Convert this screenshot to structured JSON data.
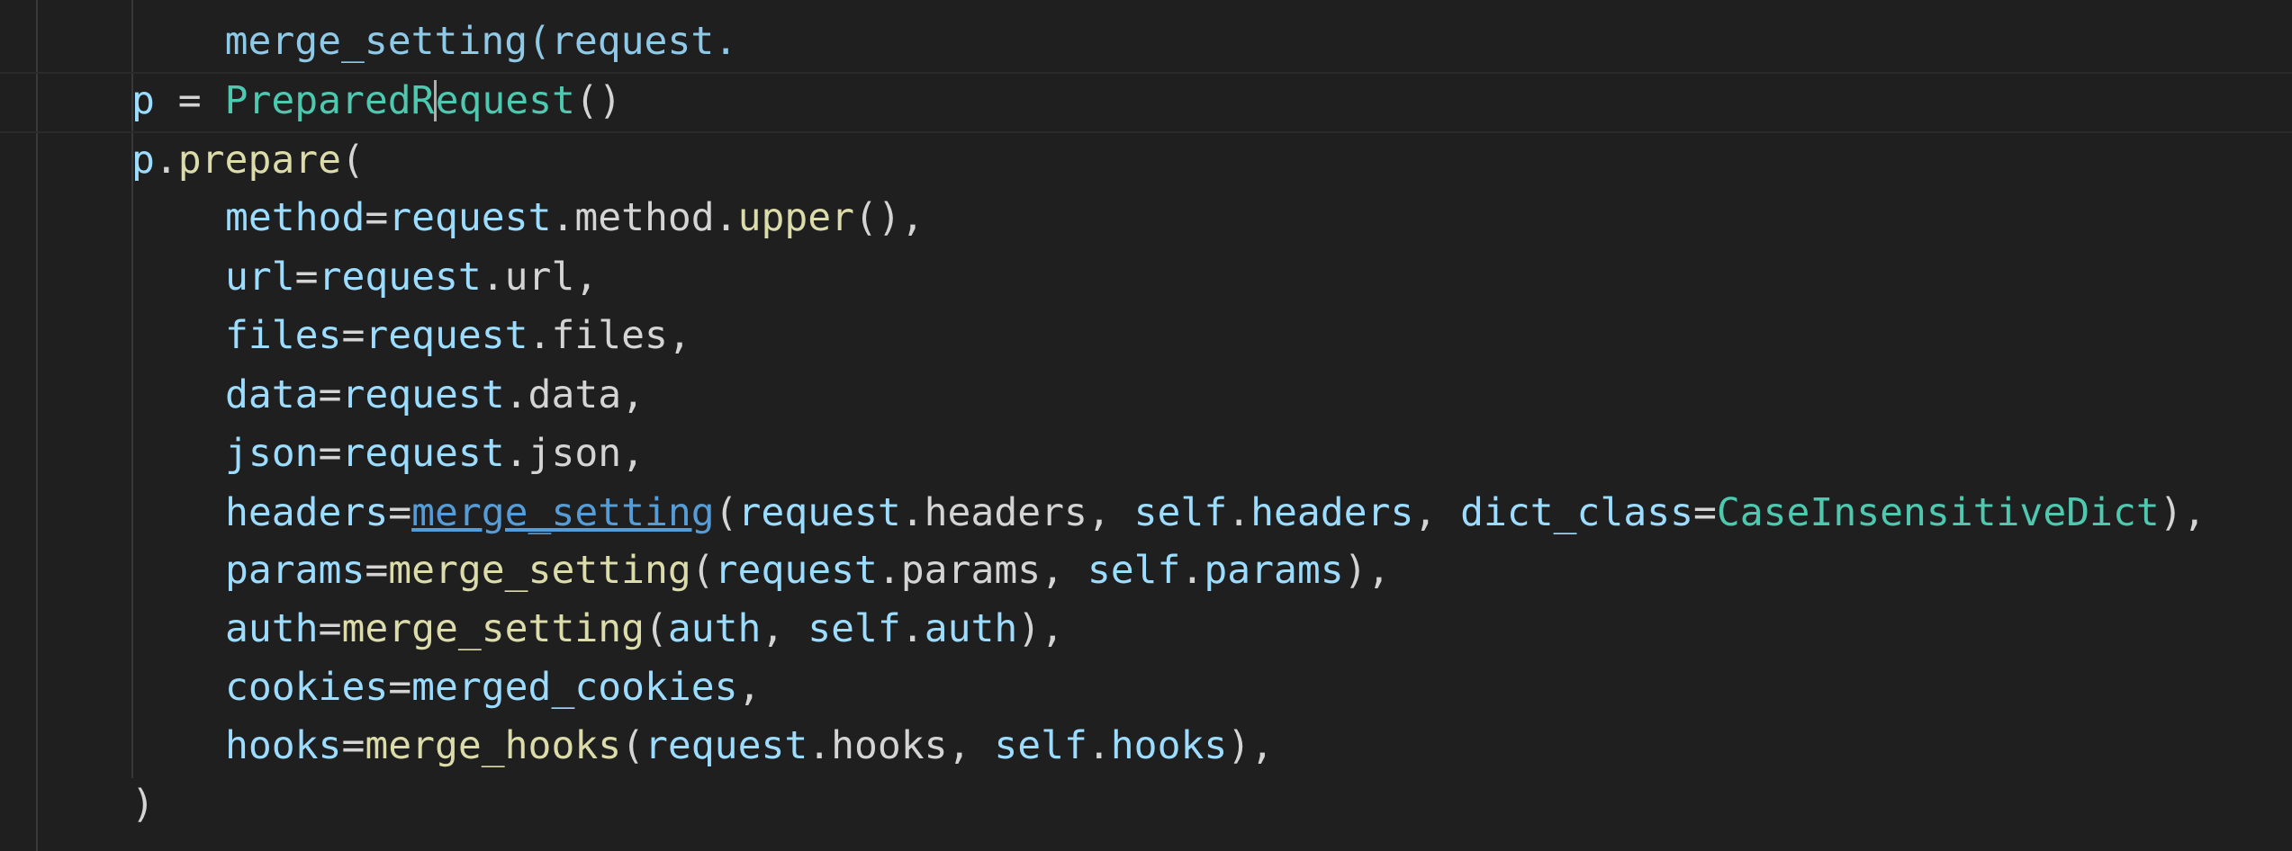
{
  "editor": {
    "colors": {
      "background": "#1f1f1f",
      "variable": "#9cdcfe",
      "class": "#4ec9b0",
      "function": "#dcdcaa",
      "plain": "#d4d4d4",
      "link": "#569cd6"
    },
    "partial_line": "merge_setting(request.",
    "lines": [
      {
        "id": "l1",
        "tokens": [
          {
            "t": "p",
            "c": "var"
          },
          {
            "t": " = ",
            "c": "plain"
          },
          {
            "t": "PreparedR",
            "c": "cls"
          },
          {
            "t": "|cursor|",
            "c": "cursor"
          },
          {
            "t": "equest",
            "c": "cls"
          },
          {
            "t": "()",
            "c": "plain"
          }
        ]
      },
      {
        "id": "l2",
        "tokens": [
          {
            "t": "p",
            "c": "var"
          },
          {
            "t": ".",
            "c": "plain"
          },
          {
            "t": "prepare",
            "c": "fn"
          },
          {
            "t": "(",
            "c": "plain"
          }
        ]
      },
      {
        "id": "l3",
        "tokens": [
          {
            "t": "method",
            "c": "var"
          },
          {
            "t": "=",
            "c": "plain"
          },
          {
            "t": "request",
            "c": "var"
          },
          {
            "t": ".method.",
            "c": "plain"
          },
          {
            "t": "upper",
            "c": "fn"
          },
          {
            "t": "(),",
            "c": "plain"
          }
        ]
      },
      {
        "id": "l4",
        "tokens": [
          {
            "t": "url",
            "c": "var"
          },
          {
            "t": "=",
            "c": "plain"
          },
          {
            "t": "request",
            "c": "var"
          },
          {
            "t": ".url,",
            "c": "plain"
          }
        ]
      },
      {
        "id": "l5",
        "tokens": [
          {
            "t": "files",
            "c": "var"
          },
          {
            "t": "=",
            "c": "plain"
          },
          {
            "t": "request",
            "c": "var"
          },
          {
            "t": ".files,",
            "c": "plain"
          }
        ]
      },
      {
        "id": "l6",
        "tokens": [
          {
            "t": "data",
            "c": "var"
          },
          {
            "t": "=",
            "c": "plain"
          },
          {
            "t": "request",
            "c": "var"
          },
          {
            "t": ".data,",
            "c": "plain"
          }
        ]
      },
      {
        "id": "l7",
        "tokens": [
          {
            "t": "json",
            "c": "var"
          },
          {
            "t": "=",
            "c": "plain"
          },
          {
            "t": "request",
            "c": "var"
          },
          {
            "t": ".json,",
            "c": "plain"
          }
        ]
      },
      {
        "id": "l8",
        "tokens": [
          {
            "t": "headers",
            "c": "var"
          },
          {
            "t": "=",
            "c": "plain"
          },
          {
            "t": "merge_setting",
            "c": "link"
          },
          {
            "t": "(",
            "c": "plain"
          },
          {
            "t": "request",
            "c": "var"
          },
          {
            "t": ".headers, ",
            "c": "plain"
          },
          {
            "t": "self",
            "c": "self"
          },
          {
            "t": ".",
            "c": "plain"
          },
          {
            "t": "headers",
            "c": "var"
          },
          {
            "t": ", ",
            "c": "plain"
          },
          {
            "t": "dict_class",
            "c": "var"
          },
          {
            "t": "=",
            "c": "plain"
          },
          {
            "t": "CaseInsensitiveDict",
            "c": "cls"
          },
          {
            "t": "),",
            "c": "plain"
          }
        ]
      },
      {
        "id": "l9",
        "tokens": [
          {
            "t": "params",
            "c": "var"
          },
          {
            "t": "=",
            "c": "plain"
          },
          {
            "t": "merge_setting",
            "c": "fn"
          },
          {
            "t": "(",
            "c": "plain"
          },
          {
            "t": "request",
            "c": "var"
          },
          {
            "t": ".params, ",
            "c": "plain"
          },
          {
            "t": "self",
            "c": "self"
          },
          {
            "t": ".",
            "c": "plain"
          },
          {
            "t": "params",
            "c": "var"
          },
          {
            "t": "),",
            "c": "plain"
          }
        ]
      },
      {
        "id": "l10",
        "tokens": [
          {
            "t": "auth",
            "c": "var"
          },
          {
            "t": "=",
            "c": "plain"
          },
          {
            "t": "merge_setting",
            "c": "fn"
          },
          {
            "t": "(",
            "c": "plain"
          },
          {
            "t": "auth",
            "c": "var"
          },
          {
            "t": ", ",
            "c": "plain"
          },
          {
            "t": "self",
            "c": "self"
          },
          {
            "t": ".",
            "c": "plain"
          },
          {
            "t": "auth",
            "c": "var"
          },
          {
            "t": "),",
            "c": "plain"
          }
        ]
      },
      {
        "id": "l11",
        "tokens": [
          {
            "t": "cookies",
            "c": "var"
          },
          {
            "t": "=",
            "c": "plain"
          },
          {
            "t": "merged_cookies",
            "c": "var"
          },
          {
            "t": ",",
            "c": "plain"
          }
        ]
      },
      {
        "id": "l12",
        "tokens": [
          {
            "t": "hooks",
            "c": "var"
          },
          {
            "t": "=",
            "c": "plain"
          },
          {
            "t": "merge_hooks",
            "c": "fn"
          },
          {
            "t": "(",
            "c": "plain"
          },
          {
            "t": "request",
            "c": "var"
          },
          {
            "t": ".hooks, ",
            "c": "plain"
          },
          {
            "t": "self",
            "c": "self"
          },
          {
            "t": ".",
            "c": "plain"
          },
          {
            "t": "hooks",
            "c": "var"
          },
          {
            "t": "),",
            "c": "plain"
          }
        ]
      },
      {
        "id": "l13",
        "tokens": [
          {
            "t": ")",
            "c": "plain"
          }
        ]
      }
    ]
  }
}
